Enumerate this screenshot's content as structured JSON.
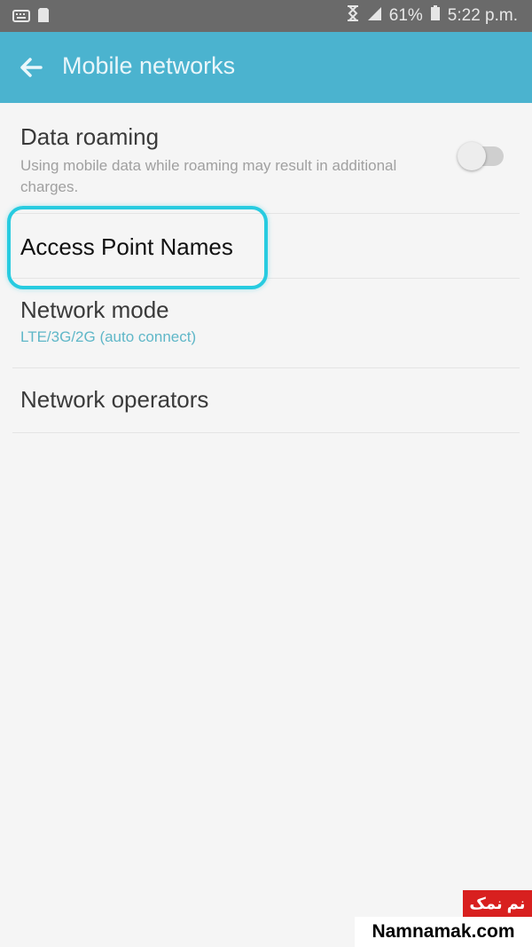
{
  "status_bar": {
    "battery": "61%",
    "time": "5:22 p.m.",
    "left_icons": [
      "keyboard-icon",
      "sd-card-icon"
    ],
    "right_icons": [
      "hourglass-icon",
      "signal-icon",
      "battery-icon"
    ]
  },
  "app_bar": {
    "title": "Mobile networks",
    "back_icon": "arrow-left-icon",
    "color": "#4bb3cf"
  },
  "settings": {
    "data_roaming": {
      "title": "Data roaming",
      "subtitle": "Using mobile data while roaming may result in additional charges.",
      "enabled": false
    },
    "access_point_names": {
      "title": "Access Point Names",
      "highlight_color": "#27cbe0"
    },
    "network_mode": {
      "title": "Network mode",
      "subtitle": "LTE/3G/2G (auto connect)"
    },
    "network_operators": {
      "title": "Network operators"
    }
  },
  "watermark": {
    "persian": "نم نمک",
    "site": "Namnamak.com"
  }
}
